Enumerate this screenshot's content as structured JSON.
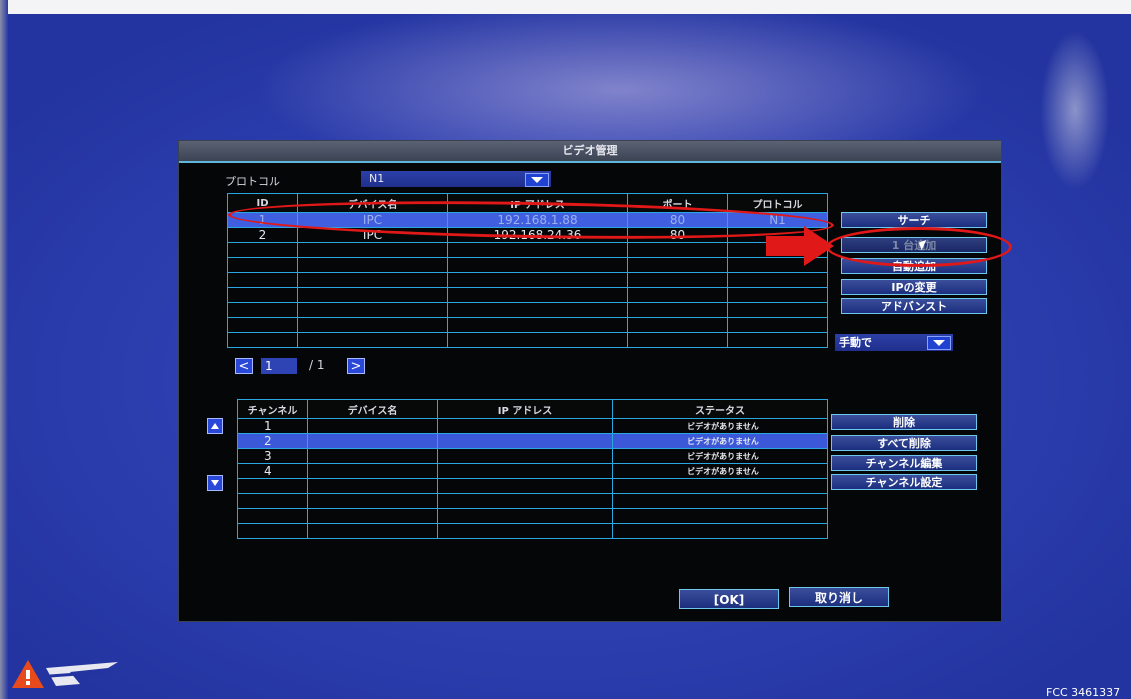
{
  "dialog": {
    "title": "ビデオ管理",
    "protocol_label": "プロトコル",
    "protocol_value": "N1",
    "device_table": {
      "headers": [
        "ID",
        "デバイス名",
        "IP アドレス",
        "ポート",
        "プロトコル"
      ],
      "rows": [
        [
          "1",
          "IPC",
          "192.168.1.88",
          "80",
          "N1"
        ],
        [
          "2",
          "IPC",
          "192.168.24.36",
          "80",
          ""
        ],
        [
          "",
          "",
          "",
          "",
          ""
        ],
        [
          "",
          "",
          "",
          "",
          ""
        ],
        [
          "",
          "",
          "",
          "",
          ""
        ],
        [
          "",
          "",
          "",
          "",
          ""
        ],
        [
          "",
          "",
          "",
          "",
          ""
        ],
        [
          "",
          "",
          "",
          "",
          ""
        ],
        [
          "",
          "",
          "",
          "",
          ""
        ]
      ]
    },
    "pager": {
      "prev": "<",
      "current": "1",
      "total": "/ 1",
      "next": ">"
    },
    "side_buttons": {
      "search": "サーチ",
      "add_one": "1 台追加",
      "auto_add": "自動追加",
      "change_ip": "IPの変更",
      "advanced": "アドバンスト"
    },
    "mode_select": "手動で",
    "channel_table": {
      "headers": [
        "チャンネル",
        "デバイス名",
        "IP アドレス",
        "ステータス"
      ],
      "rows": [
        [
          "1",
          "",
          "",
          "ビデオがありません"
        ],
        [
          "2",
          "",
          "",
          "ビデオがありません"
        ],
        [
          "3",
          "",
          "",
          "ビデオがありません"
        ],
        [
          "4",
          "",
          "",
          "ビデオがありません"
        ],
        [
          "",
          "",
          "",
          ""
        ],
        [
          "",
          "",
          "",
          ""
        ],
        [
          "",
          "",
          "",
          ""
        ],
        [
          "",
          "",
          "",
          ""
        ]
      ]
    },
    "channel_buttons": {
      "delete": "削除",
      "delete_all": "すべて削除",
      "edit_channel": "チャンネル編集",
      "channel_settings": "チャンネル設定"
    },
    "ok_label": "[OK]",
    "cancel_label": "取り消し"
  },
  "footer": {
    "serial": "FCC 3461337"
  },
  "colors": {
    "highlight_red": "#e01818",
    "grid_cyan": "#2aa6e0",
    "selected_row": "#3f5fe0"
  }
}
